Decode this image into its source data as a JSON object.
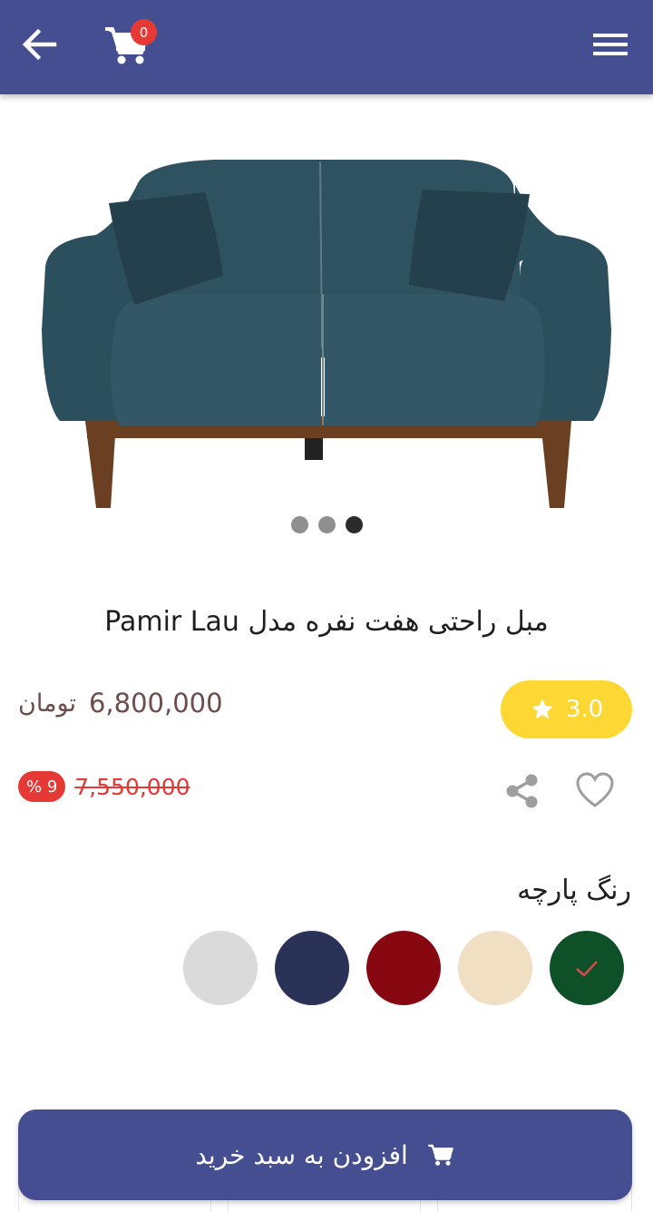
{
  "header": {
    "back_icon": "arrow-left-icon",
    "cart_icon": "shopping-cart-icon",
    "cart_count": "0",
    "menu_icon": "hamburger-menu-icon",
    "background_color": "#454e91"
  },
  "gallery": {
    "image": "sofa-product-image",
    "slides": 3,
    "active_slide": 3
  },
  "product": {
    "title": "مبل راحتی هفت نفره مدل Pamir Lau",
    "price": "6,800,000",
    "currency": "تومان",
    "old_price": "7,550,000",
    "discount": "% 9",
    "rating": "3.0"
  },
  "actions": {
    "share_icon": "share-icon",
    "favorite_icon": "heart-outline-icon"
  },
  "fabric_color": {
    "label": "رنگ پارچه",
    "options": [
      {
        "color": "#0e5128",
        "selected": true
      },
      {
        "color": "#f1dfc3",
        "selected": false
      },
      {
        "color": "#870711",
        "selected": false
      },
      {
        "color": "#2a3357",
        "selected": false
      },
      {
        "color": "#dadada",
        "selected": false
      }
    ]
  },
  "cart_button": {
    "label": "افزودن به سبد خرید",
    "icon": "shopping-cart-icon"
  }
}
